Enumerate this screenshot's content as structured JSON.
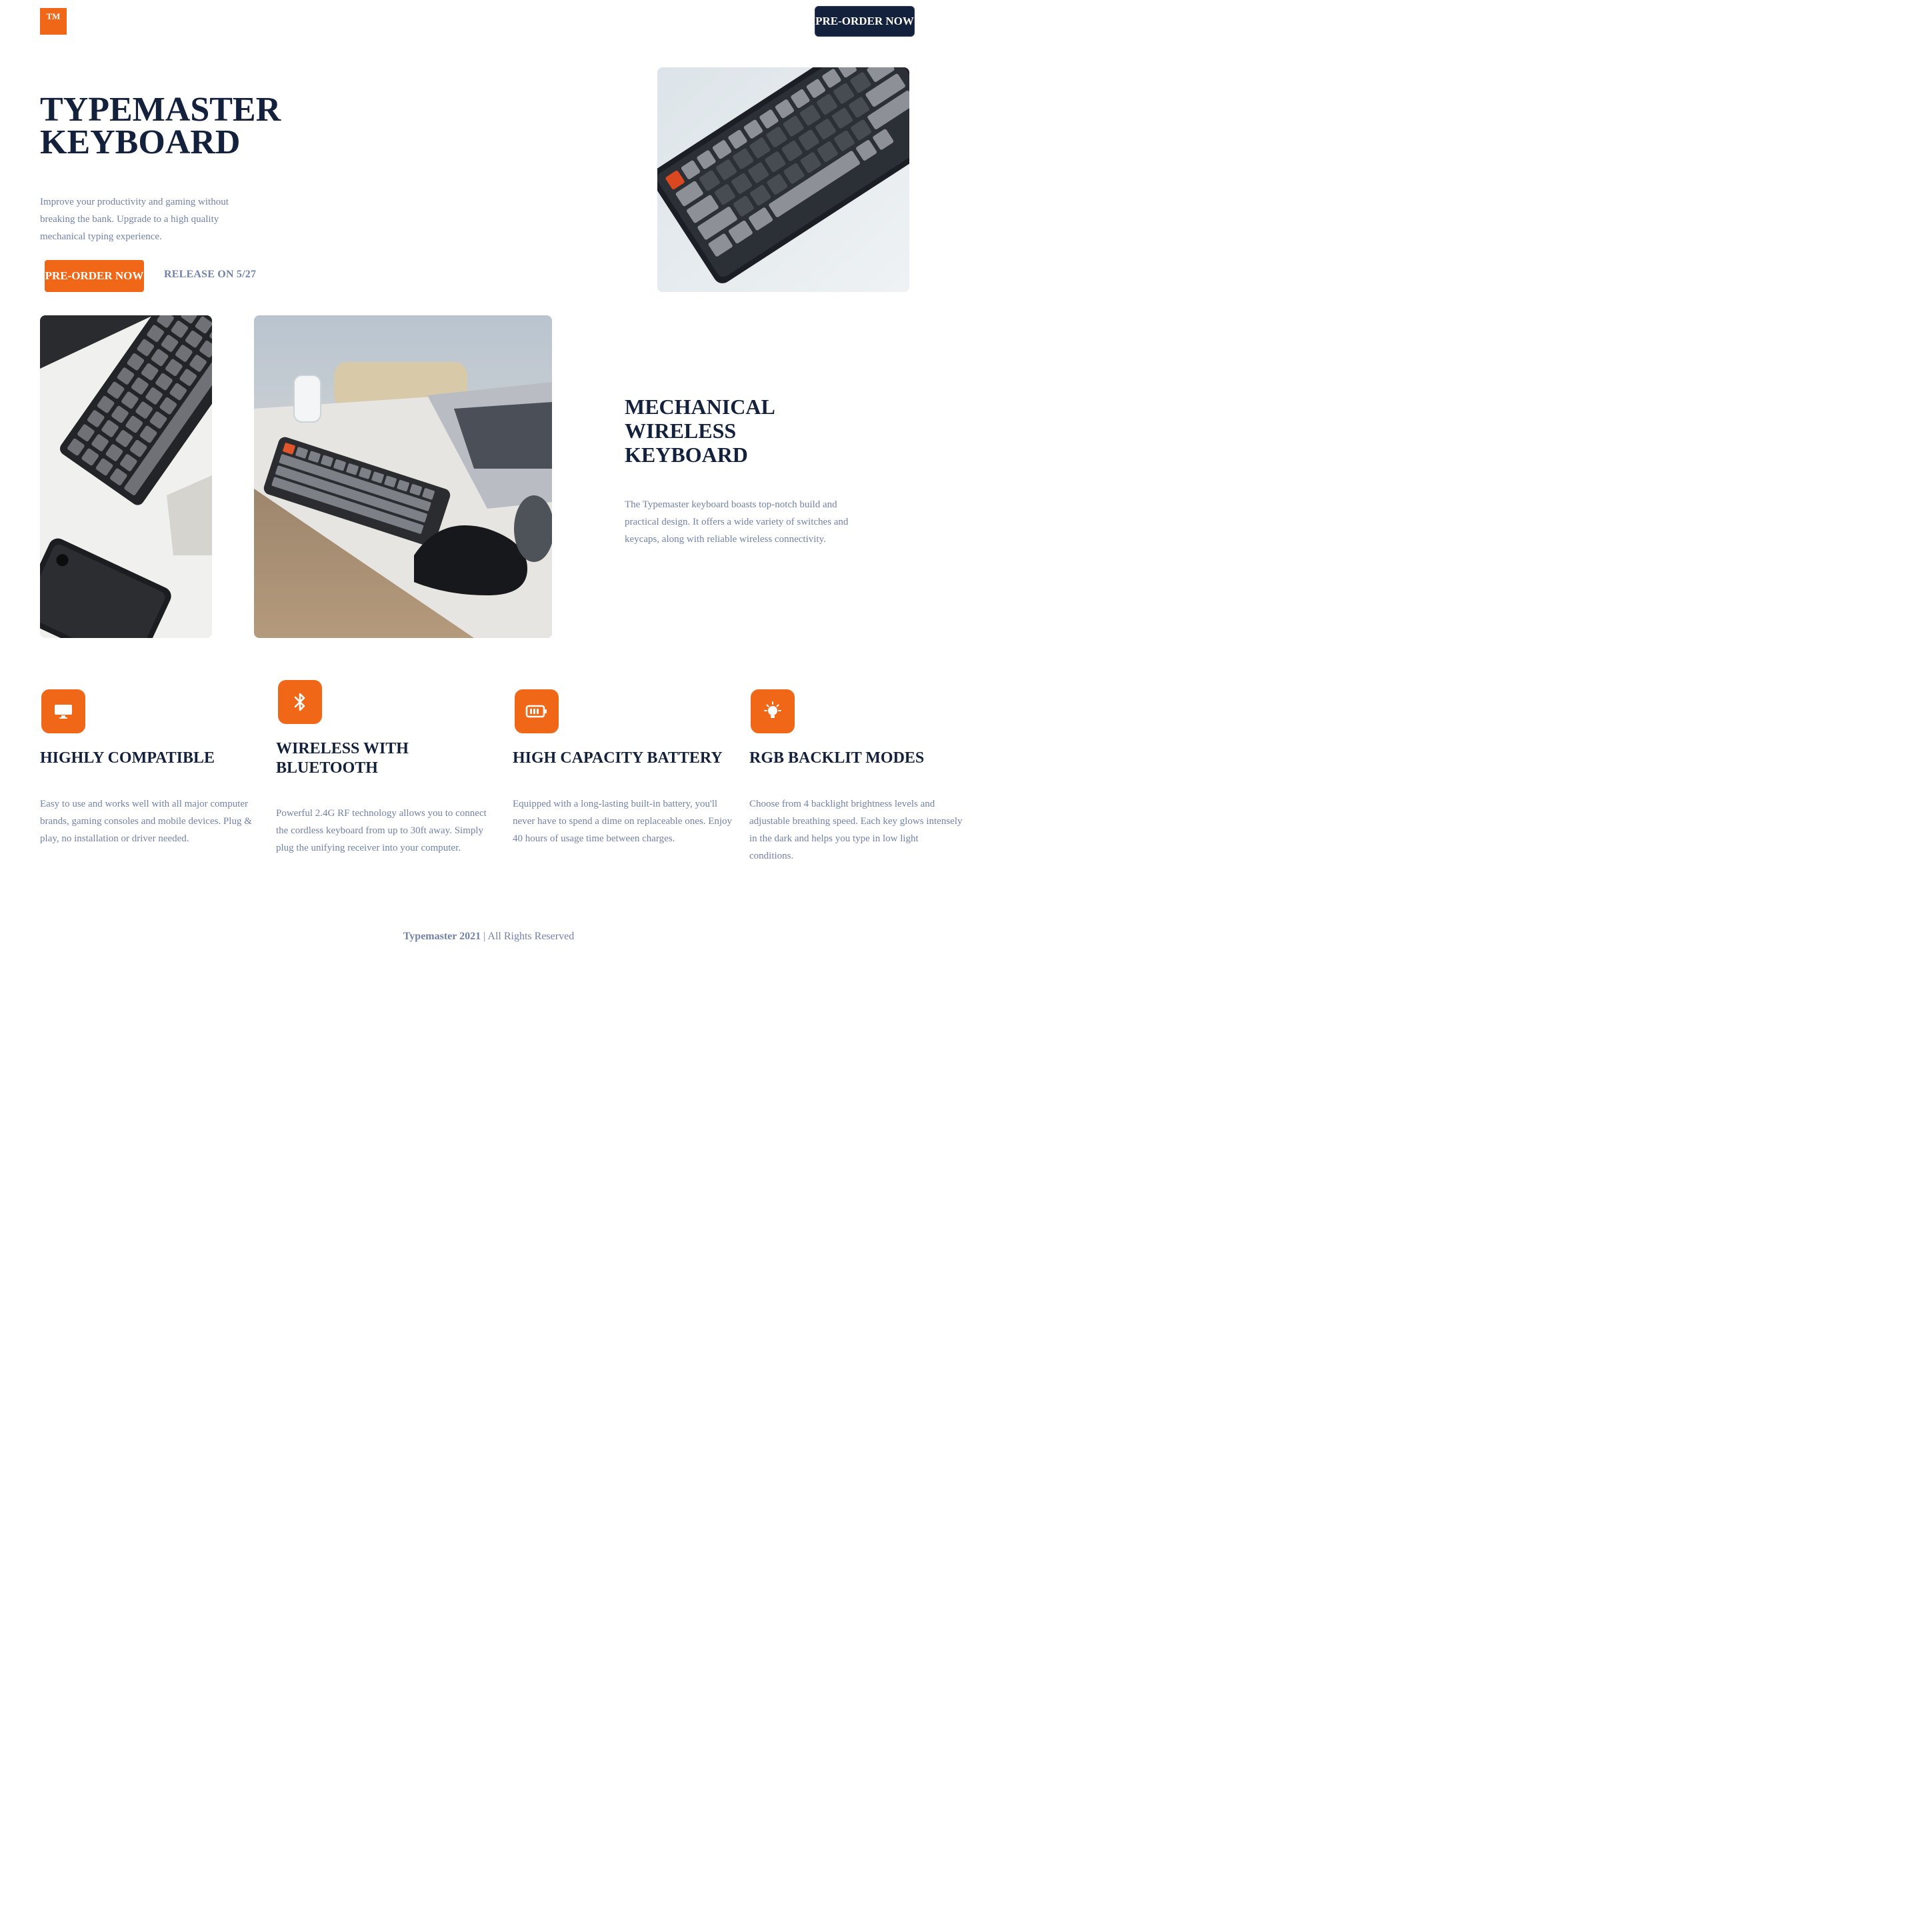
{
  "nav": {
    "logo_text": "TM",
    "cta_label": "PRE-ORDER NOW"
  },
  "hero": {
    "title_line1": "TYPEMASTER",
    "title_line2": "KEYBOARD",
    "description": "Improve your productivity and gaming without breaking the bank. Upgrade to a high quality mechanical typing experience.",
    "cta_label": "PRE-ORDER NOW",
    "release_text": "RELEASE ON 5/27"
  },
  "section": {
    "title_line1": "MECHANICAL",
    "title_line2": "WIRELESS",
    "title_line3": "KEYBOARD",
    "description": "The Typemaster keyboard boasts top-notch build and practical design. It offers a wide variety of switches and keycaps, along with reliable wireless connectivity."
  },
  "features": [
    {
      "icon": "monitor-icon",
      "title": "HIGHLY COMPATIBLE",
      "description": "Easy to use and works well with all major computer brands, gaming consoles and mobile devices. Plug & play, no installation or driver needed."
    },
    {
      "icon": "bluetooth-icon",
      "title": "WIRELESS WITH BLUETOOTH",
      "description": "Powerful 2.4G RF technology allows you to connect the cordless keyboard from up to 30ft away. Simply plug the unifying receiver into your computer."
    },
    {
      "icon": "battery-icon",
      "title": "HIGH CAPACITY BATTERY",
      "description": "Equipped with a long-lasting built-in battery, you'll never have to spend a dime on replaceable ones. Enjoy 40 hours of usage time between charges."
    },
    {
      "icon": "lightbulb-icon",
      "title": "RGB BACKLIT MODES",
      "description": "Choose from 4 backlight brightness levels and adjustable breathing speed. Each key glows intensely in the dark and helps you type in low light conditions."
    }
  ],
  "footer": {
    "brand": "Typemaster 2021",
    "separator": "|",
    "rights": "All Rights Reserved"
  },
  "colors": {
    "accent": "#f16718",
    "navy": "#13213c",
    "muted_text": "#7382a8"
  }
}
